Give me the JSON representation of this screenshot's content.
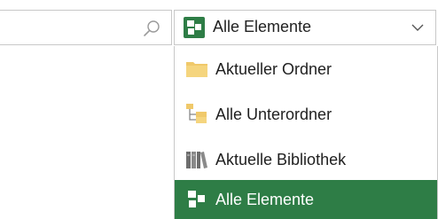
{
  "search": {
    "placeholder": "",
    "icon": "search-icon"
  },
  "scope": {
    "selected_label": "Alle Elemente",
    "icon": "all-items-icon",
    "chevron": "chevron-down-icon"
  },
  "menu": {
    "items": [
      {
        "label": "Aktueller Ordner",
        "icon": "folder-icon",
        "selected": false
      },
      {
        "label": "Alle Unterordner",
        "icon": "subfolders-icon",
        "selected": false
      },
      {
        "label": "Aktuelle Bibliothek",
        "icon": "library-icon",
        "selected": false
      },
      {
        "label": "Alle Elemente",
        "icon": "all-items-icon",
        "selected": true
      }
    ]
  },
  "colors": {
    "accent": "#2e7d46",
    "border": "#c8c8c8",
    "folder": "#f0c96a"
  }
}
